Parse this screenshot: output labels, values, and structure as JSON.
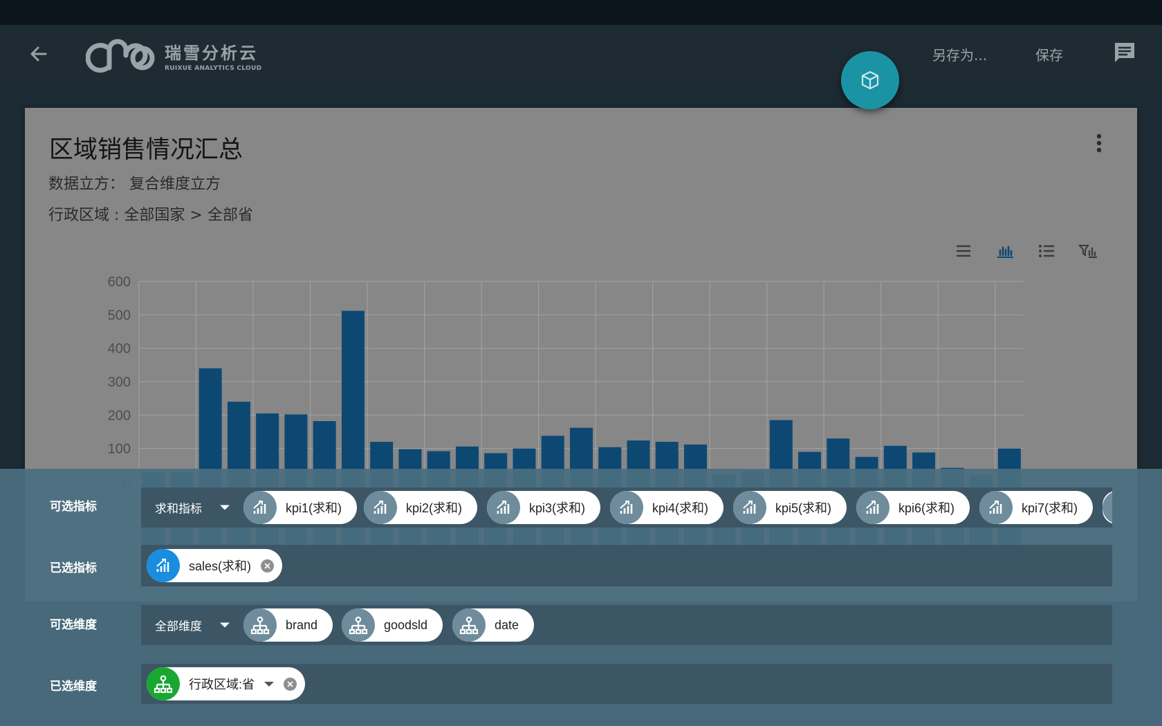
{
  "app": {
    "logo_cn": "瑞雪分析云",
    "logo_en": "RUIXUE ANALYTICS CLOUD",
    "save_as_label": "另存为...",
    "save_label": "保存",
    "icons": {
      "back": "arrow-left-icon",
      "chat": "message-icon",
      "fab": "cube-icon",
      "menu": "more-vertical-icon"
    }
  },
  "card": {
    "title": "区域销售情况汇总",
    "cube_line": "数据立方： 复合维度立方",
    "region_line": "行政区域 : 全部国家 > 全部省",
    "view_icons": [
      "list-view-icon",
      "bar-chart-icon",
      "detail-list-icon",
      "filter-chart-icon"
    ],
    "active_view": "bar-chart-icon"
  },
  "chart_data": {
    "type": "bar",
    "series": [
      {
        "values": [
          30,
          30,
          340,
          240,
          205,
          202,
          182,
          512,
          120,
          98,
          92,
          106,
          86,
          100,
          138,
          162,
          104,
          124,
          120,
          112,
          22,
          34,
          185,
          90,
          130,
          75,
          108,
          88,
          42,
          20,
          100
        ]
      }
    ],
    "ylim": [
      0,
      600
    ],
    "yticks": [
      0,
      100,
      200,
      300,
      400,
      500,
      600
    ],
    "grid": true,
    "bar_color": "#0d4873"
  },
  "panel": {
    "optional_metrics": {
      "label": "可选指标",
      "dropdown": "求和指标",
      "chips": [
        "kpi1(求和)",
        "kpi2(求和)",
        "kpi3(求和)",
        "kpi4(求和)",
        "kpi5(求和)",
        "kpi6(求和)",
        "kpi7(求和)"
      ]
    },
    "selected_metrics": {
      "label": "已选指标",
      "chips": [
        "sales(求和)"
      ]
    },
    "optional_dims": {
      "label": "可选维度",
      "dropdown": "全部维度",
      "chips": [
        "brand",
        "goodsld",
        "date"
      ]
    },
    "selected_dims": {
      "label": "已选维度",
      "chips": [
        "行政区域:省"
      ]
    }
  }
}
